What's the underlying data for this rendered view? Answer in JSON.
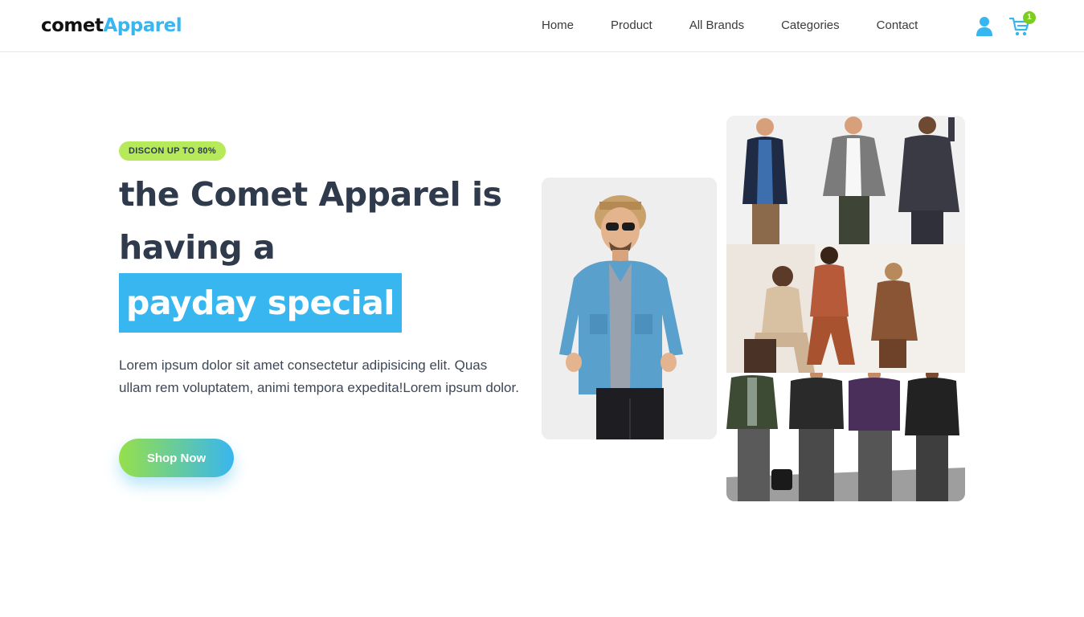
{
  "header": {
    "logo": {
      "part1": "comet",
      "part2": "Apparel"
    },
    "nav": [
      {
        "label": "Home"
      },
      {
        "label": "Product"
      },
      {
        "label": "All Brands"
      },
      {
        "label": "Categories"
      },
      {
        "label": "Contact"
      }
    ],
    "icons": {
      "user": "user-icon",
      "cart": "cart-icon"
    },
    "cart_count": "1",
    "scroll_progress": 0.2
  },
  "hero": {
    "badge": "DISCON UP TO 80%",
    "title_line1": "the Comet Apparel is",
    "title_line2": "having a",
    "title_highlight": "payday special",
    "description": "Lorem ipsum dolor sit amet consectetur adipisicing elit. Quas ullam rem voluptatem, animi tempora expedita!Lorem ipsum dolor.",
    "cta_label": "Shop Now"
  },
  "colors": {
    "accent": "#38b6ef",
    "badge_green": "#b6ea5b",
    "cart_badge": "#7ccd1f",
    "heading": "#2f3b4c"
  }
}
